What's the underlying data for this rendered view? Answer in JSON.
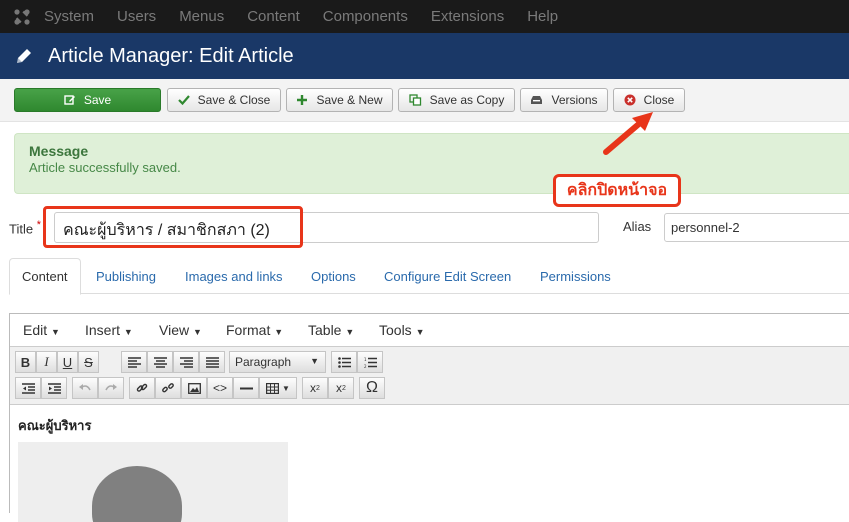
{
  "topnav": {
    "logo_icon": "joomla-logo-icon",
    "items": [
      "System",
      "Users",
      "Menus",
      "Content",
      "Components",
      "Extensions",
      "Help"
    ]
  },
  "header": {
    "icon": "pencil-icon",
    "title": "Article Manager: Edit Article"
  },
  "toolbar": {
    "save_label": "Save",
    "save_close_label": "Save & Close",
    "save_new_label": "Save & New",
    "save_copy_label": "Save as Copy",
    "versions_label": "Versions",
    "close_label": "Close"
  },
  "message": {
    "heading": "Message",
    "text": "Article successfully saved."
  },
  "annotation": {
    "callout_text": "คลิกปิดหน้าจอ",
    "color": "#e8351a"
  },
  "form": {
    "title_label": "Title",
    "required_mark": "*",
    "title_value": "คณะผู้บริหาร / สมาชิกสภา (2)",
    "alias_label": "Alias",
    "alias_value": "personnel-2"
  },
  "tabs": [
    "Content",
    "Publishing",
    "Images and links",
    "Options",
    "Configure Edit Screen",
    "Permissions"
  ],
  "editor": {
    "menus": [
      "Edit",
      "Insert",
      "View",
      "Format",
      "Table",
      "Tools"
    ],
    "format_select": "Paragraph",
    "content_heading": "คณะผู้บริหาร"
  },
  "colors": {
    "topnav_bg": "#1a1a1a",
    "header_bg": "#1a3867",
    "save_green": "#2f882f",
    "success_bg": "#dff0d8",
    "link_blue": "#2a6aac",
    "annotation_red": "#e8351a"
  }
}
